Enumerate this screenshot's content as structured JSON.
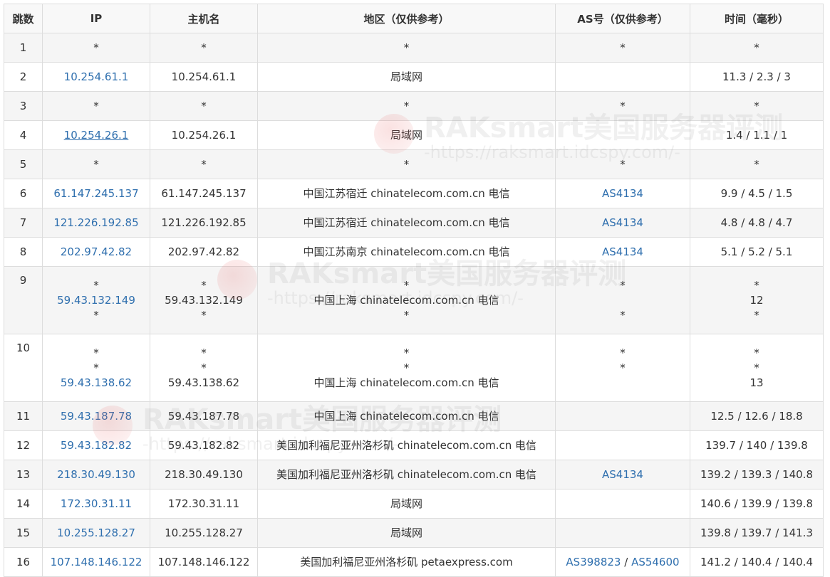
{
  "headers": [
    "跳数",
    "IP",
    "主机名",
    "地区（仅供参考）",
    "AS号（仅供参考）",
    "时间（毫秒）"
  ],
  "watermark": {
    "title": "RAKsmart美国服务器评测",
    "url": "-https://raksmart.idcspy.com/-"
  },
  "rows": [
    {
      "hop": "1",
      "ip": [
        "*"
      ],
      "host": [
        "*"
      ],
      "region": [
        "*"
      ],
      "as": [
        "*"
      ],
      "time": [
        "*"
      ]
    },
    {
      "hop": "2",
      "ip": [
        "10.254.61.1"
      ],
      "host": [
        "10.254.61.1"
      ],
      "region": [
        "局域网"
      ],
      "as": [
        ""
      ],
      "time": [
        "11.3 / 2.3 / 3"
      ]
    },
    {
      "hop": "3",
      "ip": [
        "*"
      ],
      "host": [
        "*"
      ],
      "region": [
        "*"
      ],
      "as": [
        "*"
      ],
      "time": [
        "*"
      ]
    },
    {
      "hop": "4",
      "ip": [
        "10.254.26.1"
      ],
      "host": [
        "10.254.26.1"
      ],
      "region": [
        "局域网"
      ],
      "as": [
        ""
      ],
      "time": [
        "1.4 / 1.1 / 1"
      ]
    },
    {
      "hop": "5",
      "ip": [
        "*"
      ],
      "host": [
        "*"
      ],
      "region": [
        "*"
      ],
      "as": [
        "*"
      ],
      "time": [
        "*"
      ]
    },
    {
      "hop": "6",
      "ip": [
        "61.147.245.137"
      ],
      "host": [
        "61.147.245.137"
      ],
      "region": [
        "中国江苏宿迁 chinatelecom.com.cn 电信"
      ],
      "as": [
        "AS4134"
      ],
      "time": [
        "9.9 / 4.5 / 1.5"
      ]
    },
    {
      "hop": "7",
      "ip": [
        "121.226.192.85"
      ],
      "host": [
        "121.226.192.85"
      ],
      "region": [
        "中国江苏宿迁 chinatelecom.com.cn 电信"
      ],
      "as": [
        "AS4134"
      ],
      "time": [
        "4.8 / 4.8 / 4.7"
      ]
    },
    {
      "hop": "8",
      "ip": [
        "202.97.42.82"
      ],
      "host": [
        "202.97.42.82"
      ],
      "region": [
        "中国江苏南京 chinatelecom.com.cn 电信"
      ],
      "as": [
        "AS4134"
      ],
      "time": [
        "5.1 / 5.2 / 5.1"
      ]
    },
    {
      "hop": "9",
      "ip": [
        "*",
        "59.43.132.149",
        "*"
      ],
      "host": [
        "*",
        "59.43.132.149",
        "*"
      ],
      "region": [
        "*",
        "中国上海 chinatelecom.com.cn 电信",
        "*"
      ],
      "as": [
        "*",
        "",
        "*"
      ],
      "time": [
        "*",
        "12",
        "*"
      ]
    },
    {
      "hop": "10",
      "ip": [
        "*",
        "*",
        "59.43.138.62"
      ],
      "host": [
        "*",
        "*",
        "59.43.138.62"
      ],
      "region": [
        "*",
        "*",
        "中国上海 chinatelecom.com.cn 电信"
      ],
      "as": [
        "*",
        "*",
        ""
      ],
      "time": [
        "*",
        "*",
        "13"
      ]
    },
    {
      "hop": "11",
      "ip": [
        "59.43.187.78"
      ],
      "host": [
        "59.43.187.78"
      ],
      "region": [
        "中国上海 chinatelecom.com.cn 电信"
      ],
      "as": [
        ""
      ],
      "time": [
        "12.5 / 12.6 / 18.8"
      ]
    },
    {
      "hop": "12",
      "ip": [
        "59.43.182.82"
      ],
      "host": [
        "59.43.182.82"
      ],
      "region": [
        "美国加利福尼亚州洛杉矶 chinatelecom.com.cn 电信"
      ],
      "as": [
        ""
      ],
      "time": [
        "139.7 / 140 / 139.8"
      ]
    },
    {
      "hop": "13",
      "ip": [
        "218.30.49.130"
      ],
      "host": [
        "218.30.49.130"
      ],
      "region": [
        "美国加利福尼亚州洛杉矶 chinatelecom.com.cn 电信"
      ],
      "as": [
        "AS4134"
      ],
      "time": [
        "139.2 / 139.3 / 140.8"
      ]
    },
    {
      "hop": "14",
      "ip": [
        "172.30.31.11"
      ],
      "host": [
        "172.30.31.11"
      ],
      "region": [
        "局域网"
      ],
      "as": [
        ""
      ],
      "time": [
        "140.6 / 139.9 / 139.8"
      ]
    },
    {
      "hop": "15",
      "ip": [
        "10.255.128.27"
      ],
      "host": [
        "10.255.128.27"
      ],
      "region": [
        "局域网"
      ],
      "as": [
        ""
      ],
      "time": [
        "139.8 / 139.7 / 141.3"
      ]
    },
    {
      "hop": "16",
      "ip": [
        "107.148.146.122"
      ],
      "host": [
        "107.148.146.122"
      ],
      "region": [
        "美国加利福尼亚州洛杉矶 petaexpress.com"
      ],
      "as": [
        "AS398823",
        "AS54600"
      ],
      "time": [
        "141.2 / 140.4 / 140.4"
      ]
    }
  ]
}
